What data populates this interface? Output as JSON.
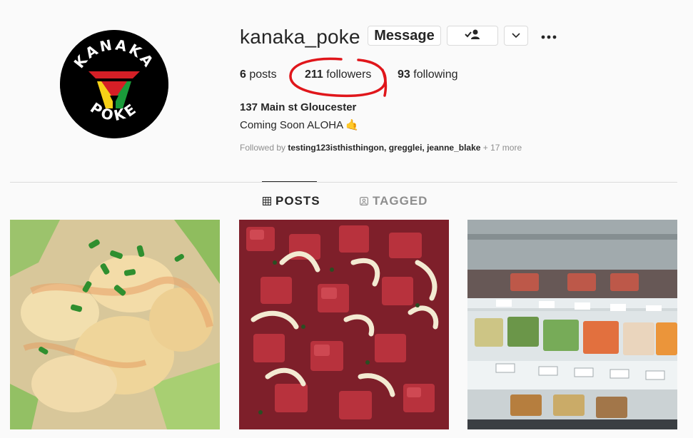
{
  "profile": {
    "username": "kanaka_poke",
    "avatar_text_top": "KANAKA",
    "avatar_text_bottom": "POKE"
  },
  "actions": {
    "message_label": "Message",
    "follow_icon": "person-check-icon",
    "dropdown_icon": "chevron-down-icon",
    "more_icon": "more-horizontal-icon"
  },
  "stats": {
    "posts_count": "6",
    "posts_label": " posts",
    "followers_count": "211",
    "followers_label": " followers",
    "following_count": "93",
    "following_label": " following"
  },
  "bio": {
    "name": "137 Main st Gloucester",
    "text": "Coming Soon ALOHA ",
    "emoji": "🤙"
  },
  "followed_by": {
    "prefix": "Followed by ",
    "names": "testing123isthisthingon, gregglei, jeanne_blake",
    "more": " + 17 more"
  },
  "tabs": [
    {
      "label": "POSTS",
      "icon": "grid-icon",
      "active": true
    },
    {
      "label": "TAGGED",
      "icon": "tag-icon",
      "active": false
    }
  ],
  "posts": [
    {
      "subject": "potato salad with green onions",
      "icon": "photo"
    },
    {
      "subject": "ahi poke with onions",
      "icon": "photo"
    },
    {
      "subject": "deli display case",
      "icon": "photo"
    }
  ],
  "colors": {
    "annotation_red": "#e0161b",
    "logo_red": "#d51f26",
    "logo_yellow": "#f7d117",
    "logo_green": "#1a9b3a",
    "text_primary": "#262626",
    "text_secondary": "#8e8e8e"
  }
}
